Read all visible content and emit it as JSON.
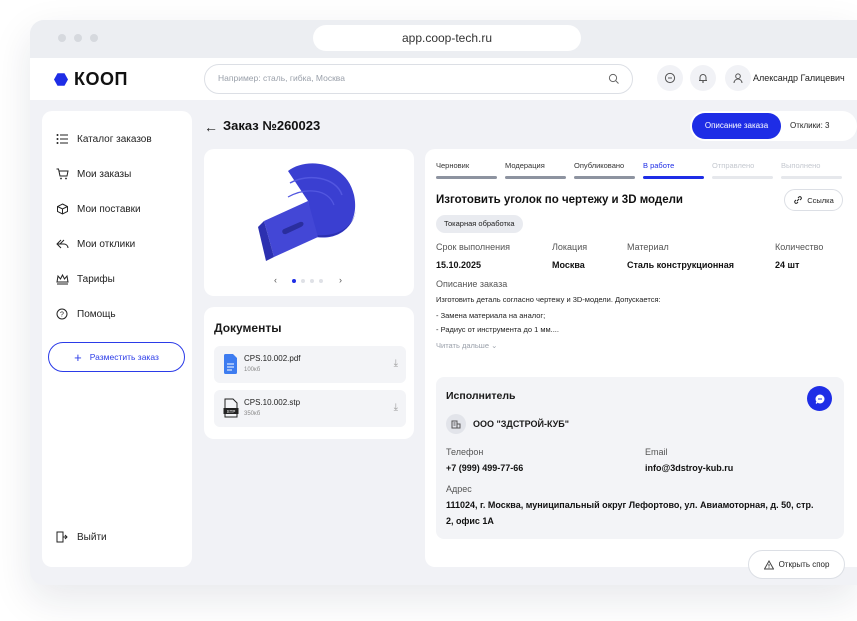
{
  "browser": {
    "url": "app.coop-tech.ru"
  },
  "header": {
    "logo_text": "КООП",
    "search_placeholder": "Например: сталь, гибка, Москва",
    "user_name": "Александр Галицевич"
  },
  "sidebar": {
    "items": [
      {
        "label": "Каталог заказов",
        "icon": "list-icon"
      },
      {
        "label": "Мои заказы",
        "icon": "cart-icon"
      },
      {
        "label": "Мои поставки",
        "icon": "box-icon"
      },
      {
        "label": "Мои отклики",
        "icon": "reply-icon"
      },
      {
        "label": "Тарифы",
        "icon": "crown-icon"
      },
      {
        "label": "Помощь",
        "icon": "help-icon"
      }
    ],
    "place_order_label": "Разместить заказ",
    "logout_label": "Выйти"
  },
  "order": {
    "title": "Заказ №260023",
    "tab_description": "Описание заказа",
    "tab_responses": "Отклики: 3"
  },
  "documents": {
    "title": "Документы",
    "files": [
      {
        "name": "CPS.10.002.pdf",
        "size": "100кб",
        "icon": "pdf-file-icon"
      },
      {
        "name": "CPS.10.002.stp",
        "size": "350кб",
        "icon": "stp-file-icon"
      }
    ]
  },
  "status_steps": [
    {
      "label": "Черновик",
      "state": "done"
    },
    {
      "label": "Модерация",
      "state": "done"
    },
    {
      "label": "Опубликовано",
      "state": "done"
    },
    {
      "label": "В работе",
      "state": "current"
    },
    {
      "label": "Отправлено",
      "state": "pending"
    },
    {
      "label": "Выполнено",
      "state": "pending"
    }
  ],
  "task": {
    "title": "Изготовить уголок по чертежу и 3D модели",
    "link_label": "Ссылка",
    "tag": "Токарная обработка",
    "deadline_label": "Срок выполнения",
    "deadline": "15.10.2025",
    "location_label": "Локация",
    "location": "Москва",
    "material_label": "Материал",
    "material": "Сталь конструкционная",
    "quantity_label": "Количество",
    "quantity": "24 шт",
    "description_label": "Описание заказа",
    "description_lines": [
      "Изготовить деталь согласно чертежу и 3D-модели. Допускается:",
      "- Замена материала на аналог;",
      "- Радиус от инструмента до 1 мм...."
    ],
    "read_more": "Читать дальше ⌄"
  },
  "executor": {
    "title": "Исполнитель",
    "company": "ООО \"ЗДСТРОЙ-КУБ\"",
    "phone_label": "Телефон",
    "phone": "+7 (999) 499-77-66",
    "email_label": "Email",
    "email": "info@3dstroy-kub.ru",
    "address_label": "Адрес",
    "address_line1": "111024, г. Москва, муниципальный округ Лефортово, ул. Авиамоторная, д. 50, стр.",
    "address_line2": "2, офис 1А"
  },
  "dispute_label": "Открыть спор",
  "colors": {
    "accent": "#1e2de6",
    "background": "#f1f2f6",
    "model": "#3a3fd1"
  }
}
